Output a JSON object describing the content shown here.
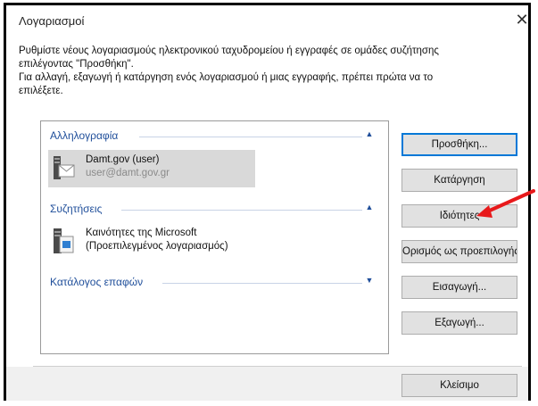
{
  "window": {
    "title": "Λογαριασμοί",
    "close_icon": "close-icon"
  },
  "description": {
    "line1": "Ρυθμίστε νέους λογαριασμούς ηλεκτρονικού ταχυδρομείου ή εγγραφές σε ομάδες συζήτησης",
    "line2": "επιλέγοντας \"Προσθήκη\".",
    "line3": "Για αλλαγή, εξαγωγή ή κατάργηση ενός λογαριασμού ή μιας εγγραφής, πρέπει πρώτα να το",
    "line4": "επιλέξετε."
  },
  "groups": {
    "mail": {
      "label": "Αλληλογραφία",
      "items": [
        {
          "name": "Damt.gov (user)",
          "sub": "user@damt.gov.gr"
        }
      ]
    },
    "news": {
      "label": "Συζητήσεις",
      "items": [
        {
          "name": "Καινότητες της Microsoft",
          "sub": "(Προεπιλεγμένος λογαριασμός)"
        }
      ]
    },
    "contacts": {
      "label": "Κατάλογος επαφών"
    }
  },
  "buttons": {
    "add": "Προσθήκη...",
    "remove": "Κατάργηση",
    "properties": "Ιδιότητες",
    "set_default": "Ορισμός ως προεπιλογής",
    "import": "Εισαγωγή...",
    "export": "Εξαγωγή...",
    "close": "Κλείσιμο"
  },
  "colors": {
    "accent": "#0078d7",
    "group_header": "#1f4e9a",
    "annotation_arrow": "#e8191b"
  }
}
